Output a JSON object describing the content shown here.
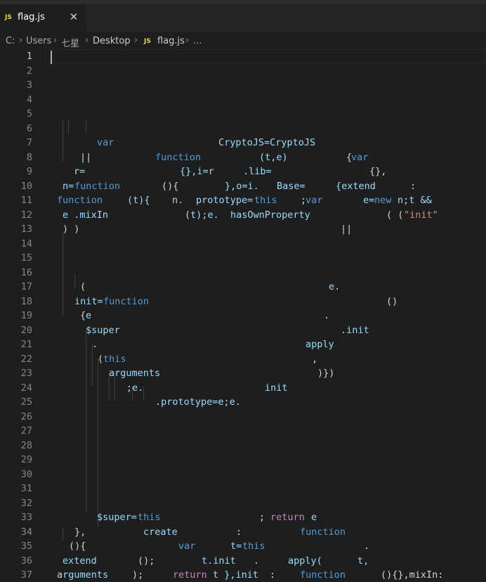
{
  "tab": {
    "icon": "JS",
    "filename": "flag.js",
    "close": "✕"
  },
  "breadcrumb": {
    "parts": [
      "C:",
      "Users",
      "七星",
      "Desktop"
    ],
    "file_icon": "JS",
    "file": "flag.js",
    "more": "...",
    "separator": "›"
  },
  "editor": {
    "active_line": 1,
    "line_numbers": [
      1,
      2,
      3,
      4,
      5,
      6,
      7,
      8,
      9,
      10,
      11,
      12,
      13,
      14,
      15,
      16,
      17,
      18,
      19,
      20,
      21,
      22,
      23,
      24,
      25,
      26,
      27,
      28,
      29,
      30,
      31,
      32,
      33,
      34,
      35,
      36,
      37
    ],
    "tokens": [
      {
        "line": 7,
        "col": 138,
        "text": "var",
        "cls": "keyword"
      },
      {
        "line": 7,
        "col": 311,
        "text": "CryptoJS=CryptoJS",
        "cls": "ident"
      },
      {
        "line": 8,
        "col": 114,
        "text": "||",
        "cls": "plain"
      },
      {
        "line": 8,
        "col": 221,
        "text": "function",
        "cls": "keyword"
      },
      {
        "line": 8,
        "col": 369,
        "text": "(t,e)",
        "cls": "ident"
      },
      {
        "line": 8,
        "col": 493,
        "text": "{",
        "cls": "plain"
      },
      {
        "line": 8,
        "col": 500,
        "text": "var",
        "cls": "keyword"
      },
      {
        "line": 9,
        "col": 105,
        "text": "r=",
        "cls": "ident"
      },
      {
        "line": 9,
        "col": 256,
        "text": "{},i=r",
        "cls": "ident"
      },
      {
        "line": 9,
        "col": 346,
        "text": ".lib=",
        "cls": "ident"
      },
      {
        "line": 9,
        "col": 526,
        "text": "{},",
        "cls": "plain"
      },
      {
        "line": 10,
        "col": 89,
        "text": "n=",
        "cls": "ident"
      },
      {
        "line": 10,
        "col": 106,
        "text": "function",
        "cls": "keyword"
      },
      {
        "line": 10,
        "col": 230,
        "text": "(){",
        "cls": "plain"
      },
      {
        "line": 10,
        "col": 320,
        "text": "},o=i.",
        "cls": "ident"
      },
      {
        "line": 10,
        "col": 394,
        "text": "Base=",
        "cls": "ident"
      },
      {
        "line": 10,
        "col": 478,
        "text": "{extend",
        "cls": "ident"
      },
      {
        "line": 10,
        "col": 584,
        "text": ":",
        "cls": "plain"
      },
      {
        "line": 11,
        "col": 81,
        "text": "function",
        "cls": "keyword"
      },
      {
        "line": 11,
        "col": 181,
        "text": "(t){",
        "cls": "ident"
      },
      {
        "line": 11,
        "col": 245,
        "text": "n.",
        "cls": "ident"
      },
      {
        "line": 11,
        "col": 279,
        "text": "prototype=",
        "cls": "ident"
      },
      {
        "line": 11,
        "col": 362,
        "text": "this",
        "cls": "keyword"
      },
      {
        "line": 11,
        "col": 428,
        "text": ";",
        "cls": "plain"
      },
      {
        "line": 11,
        "col": 435,
        "text": "var",
        "cls": "keyword"
      },
      {
        "line": 11,
        "col": 517,
        "text": "e=",
        "cls": "ident"
      },
      {
        "line": 11,
        "col": 533,
        "text": "new",
        "cls": "keyword"
      },
      {
        "line": 11,
        "col": 566,
        "text": "n;t &&",
        "cls": "ident"
      },
      {
        "line": 12,
        "col": 89,
        "text": "e .mixIn",
        "cls": "ident"
      },
      {
        "line": 12,
        "col": 263,
        "text": "(t);e.",
        "cls": "ident"
      },
      {
        "line": 12,
        "col": 328,
        "text": "hasOwnProperty",
        "cls": "ident"
      },
      {
        "line": 12,
        "col": 550,
        "text": "( (",
        "cls": "plain"
      },
      {
        "line": 12,
        "col": 575,
        "text": "\"init\"",
        "cls": "string"
      },
      {
        "line": 13,
        "col": 89,
        "text": ") )",
        "cls": "plain"
      },
      {
        "line": 13,
        "col": 485,
        "text": "||",
        "cls": "plain"
      },
      {
        "line": 17,
        "col": 114,
        "text": "(",
        "cls": "plain"
      },
      {
        "line": 17,
        "col": 468,
        "text": "e.",
        "cls": "ident"
      },
      {
        "line": 18,
        "col": 106,
        "text": "init=",
        "cls": "ident"
      },
      {
        "line": 18,
        "col": 147,
        "text": "function",
        "cls": "keyword"
      },
      {
        "line": 18,
        "col": 550,
        "text": "()",
        "cls": "plain"
      },
      {
        "line": 19,
        "col": 114,
        "text": "{",
        "cls": "plain"
      },
      {
        "line": 19,
        "col": 122,
        "text": "e",
        "cls": "ident"
      },
      {
        "line": 19,
        "col": 461,
        "text": ".",
        "cls": "plain"
      },
      {
        "line": 20,
        "col": 122,
        "text": "$super",
        "cls": "ident"
      },
      {
        "line": 20,
        "col": 485,
        "text": ".init",
        "cls": "ident"
      },
      {
        "line": 21,
        "col": 131,
        "text": ".",
        "cls": "plain"
      },
      {
        "line": 21,
        "col": 435,
        "text": "apply",
        "cls": "ident"
      },
      {
        "line": 22,
        "col": 139,
        "text": "(",
        "cls": "plain"
      },
      {
        "line": 22,
        "col": 147,
        "text": "this",
        "cls": "keyword"
      },
      {
        "line": 22,
        "col": 444,
        "text": ",",
        "cls": "plain"
      },
      {
        "line": 23,
        "col": 155,
        "text": "arguments",
        "cls": "ident"
      },
      {
        "line": 23,
        "col": 452,
        "text": ")})",
        "cls": "plain"
      },
      {
        "line": 24,
        "col": 180,
        "text": ";e.",
        "cls": "ident"
      },
      {
        "line": 24,
        "col": 377,
        "text": "init",
        "cls": "ident"
      },
      {
        "line": 25,
        "col": 221,
        "text": ".prototype=e;e.",
        "cls": "ident"
      },
      {
        "line": 33,
        "col": 138,
        "text": "$super=",
        "cls": "ident"
      },
      {
        "line": 33,
        "col": 196,
        "text": "this",
        "cls": "keyword"
      },
      {
        "line": 33,
        "col": 369,
        "text": ";",
        "cls": "plain"
      },
      {
        "line": 33,
        "col": 385,
        "text": "return",
        "cls": "control"
      },
      {
        "line": 33,
        "col": 443,
        "text": "e",
        "cls": "ident"
      },
      {
        "line": 34,
        "col": 106,
        "text": "},",
        "cls": "plain"
      },
      {
        "line": 34,
        "col": 204,
        "text": "create",
        "cls": "ident"
      },
      {
        "line": 34,
        "col": 336,
        "text": ":",
        "cls": "plain"
      },
      {
        "line": 34,
        "col": 427,
        "text": "function",
        "cls": "keyword"
      },
      {
        "line": 35,
        "col": 98,
        "text": "(){",
        "cls": "plain"
      },
      {
        "line": 35,
        "col": 254,
        "text": "var",
        "cls": "keyword"
      },
      {
        "line": 35,
        "col": 328,
        "text": "t=",
        "cls": "ident"
      },
      {
        "line": 35,
        "col": 345,
        "text": "this",
        "cls": "keyword"
      },
      {
        "line": 35,
        "col": 518,
        "text": ".",
        "cls": "plain"
      },
      {
        "line": 36,
        "col": 89,
        "text": "extend",
        "cls": "ident"
      },
      {
        "line": 36,
        "col": 196,
        "text": "();",
        "cls": "plain"
      },
      {
        "line": 36,
        "col": 287,
        "text": "t.init",
        "cls": "ident"
      },
      {
        "line": 36,
        "col": 361,
        "text": ".",
        "cls": "plain"
      },
      {
        "line": 36,
        "col": 410,
        "text": "apply(",
        "cls": "ident"
      },
      {
        "line": 36,
        "col": 509,
        "text": "t,",
        "cls": "ident"
      },
      {
        "line": 37,
        "col": 81,
        "text": "arguments",
        "cls": "ident"
      },
      {
        "line": 37,
        "col": 188,
        "text": ");",
        "cls": "plain"
      },
      {
        "line": 37,
        "col": 246,
        "text": "return",
        "cls": "control"
      },
      {
        "line": 37,
        "col": 303,
        "text": "t },init",
        "cls": "ident"
      },
      {
        "line": 37,
        "col": 384,
        "text": ":",
        "cls": "plain"
      },
      {
        "line": 37,
        "col": 427,
        "text": "function",
        "cls": "keyword"
      },
      {
        "line": 37,
        "col": 542,
        "text": "(){},mixIn:",
        "cls": "plain"
      }
    ]
  }
}
